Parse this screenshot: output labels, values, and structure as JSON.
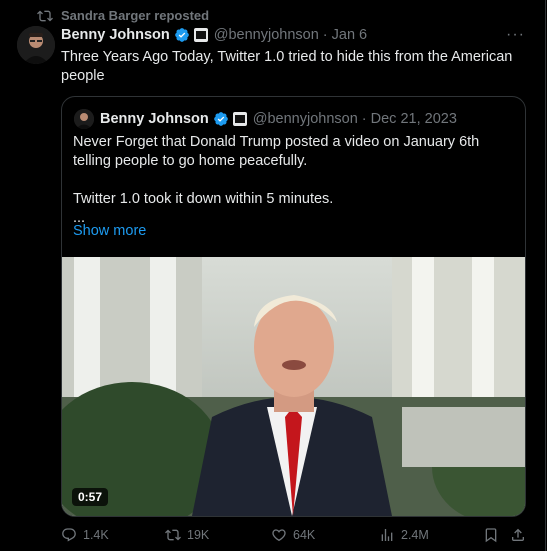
{
  "repost": {
    "text": "Sandra Barger reposted",
    "icon": "repost-icon"
  },
  "tweet": {
    "author_name": "Benny Johnson",
    "handle": "@bennyjohnson",
    "date": "Jan 6",
    "text": "Three Years Ago Today, Twitter 1.0 tried to hide this from the American people",
    "more_icon": "more-icon"
  },
  "quote": {
    "author_name": "Benny Johnson",
    "handle": "@bennyjohnson",
    "date": "Dec 21, 2023",
    "text": "Never Forget that Donald Trump posted a video on January 6th telling people to go home peacefully.\n\nTwitter 1.0 took it down within 5 minutes.\n...",
    "show_more": "Show more",
    "video_duration": "0:57"
  },
  "actions": {
    "replies": "1.4K",
    "reposts": "19K",
    "likes": "64K",
    "views": "2.4M"
  },
  "colors": {
    "accent": "#1d9bf0",
    "muted": "#71767b",
    "text": "#e7e9ea",
    "verified": "#1d9bf0"
  }
}
